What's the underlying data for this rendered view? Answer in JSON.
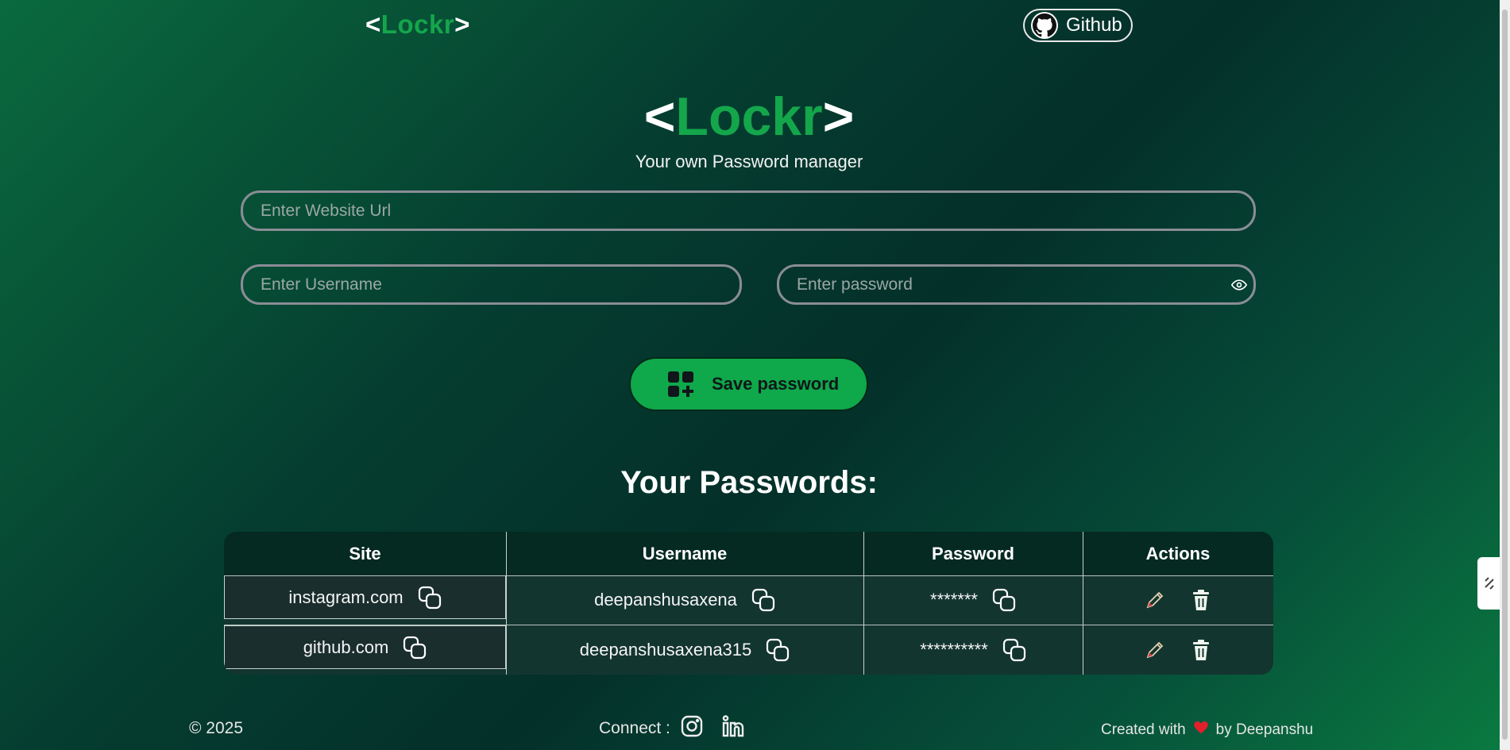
{
  "nav": {
    "logo_left": "<",
    "logo_mid": "Lockr",
    "logo_right": ">",
    "github_label": "Github"
  },
  "hero": {
    "logo_left": "<",
    "logo_mid": "Lockr",
    "logo_right": ">",
    "tagline": "Your own Password manager"
  },
  "form": {
    "url_placeholder": "Enter Website Url",
    "username_placeholder": "Enter Username",
    "password_placeholder": "Enter password",
    "save_label": "Save password"
  },
  "list": {
    "heading": "Your Passwords:",
    "columns": [
      "Site",
      "Username",
      "Password",
      "Actions"
    ],
    "rows": [
      {
        "site": "instagram.com",
        "username": "deepanshusaxena",
        "password": "*******"
      },
      {
        "site": "github.com",
        "username": "deepanshusaxena315",
        "password": "**********"
      }
    ]
  },
  "footer": {
    "copyright": "© 2025",
    "connect": "Connect :",
    "created_prefix": "Created with",
    "created_suffix": "by Deepanshu"
  },
  "colors": {
    "accent": "#14a64b",
    "heart": "#e0202a"
  },
  "icons": [
    "github-icon",
    "eye-icon",
    "add-grid-icon",
    "copy-icon",
    "edit-icon",
    "trash-icon",
    "instagram-icon",
    "linkedin-icon",
    "heart-icon"
  ]
}
